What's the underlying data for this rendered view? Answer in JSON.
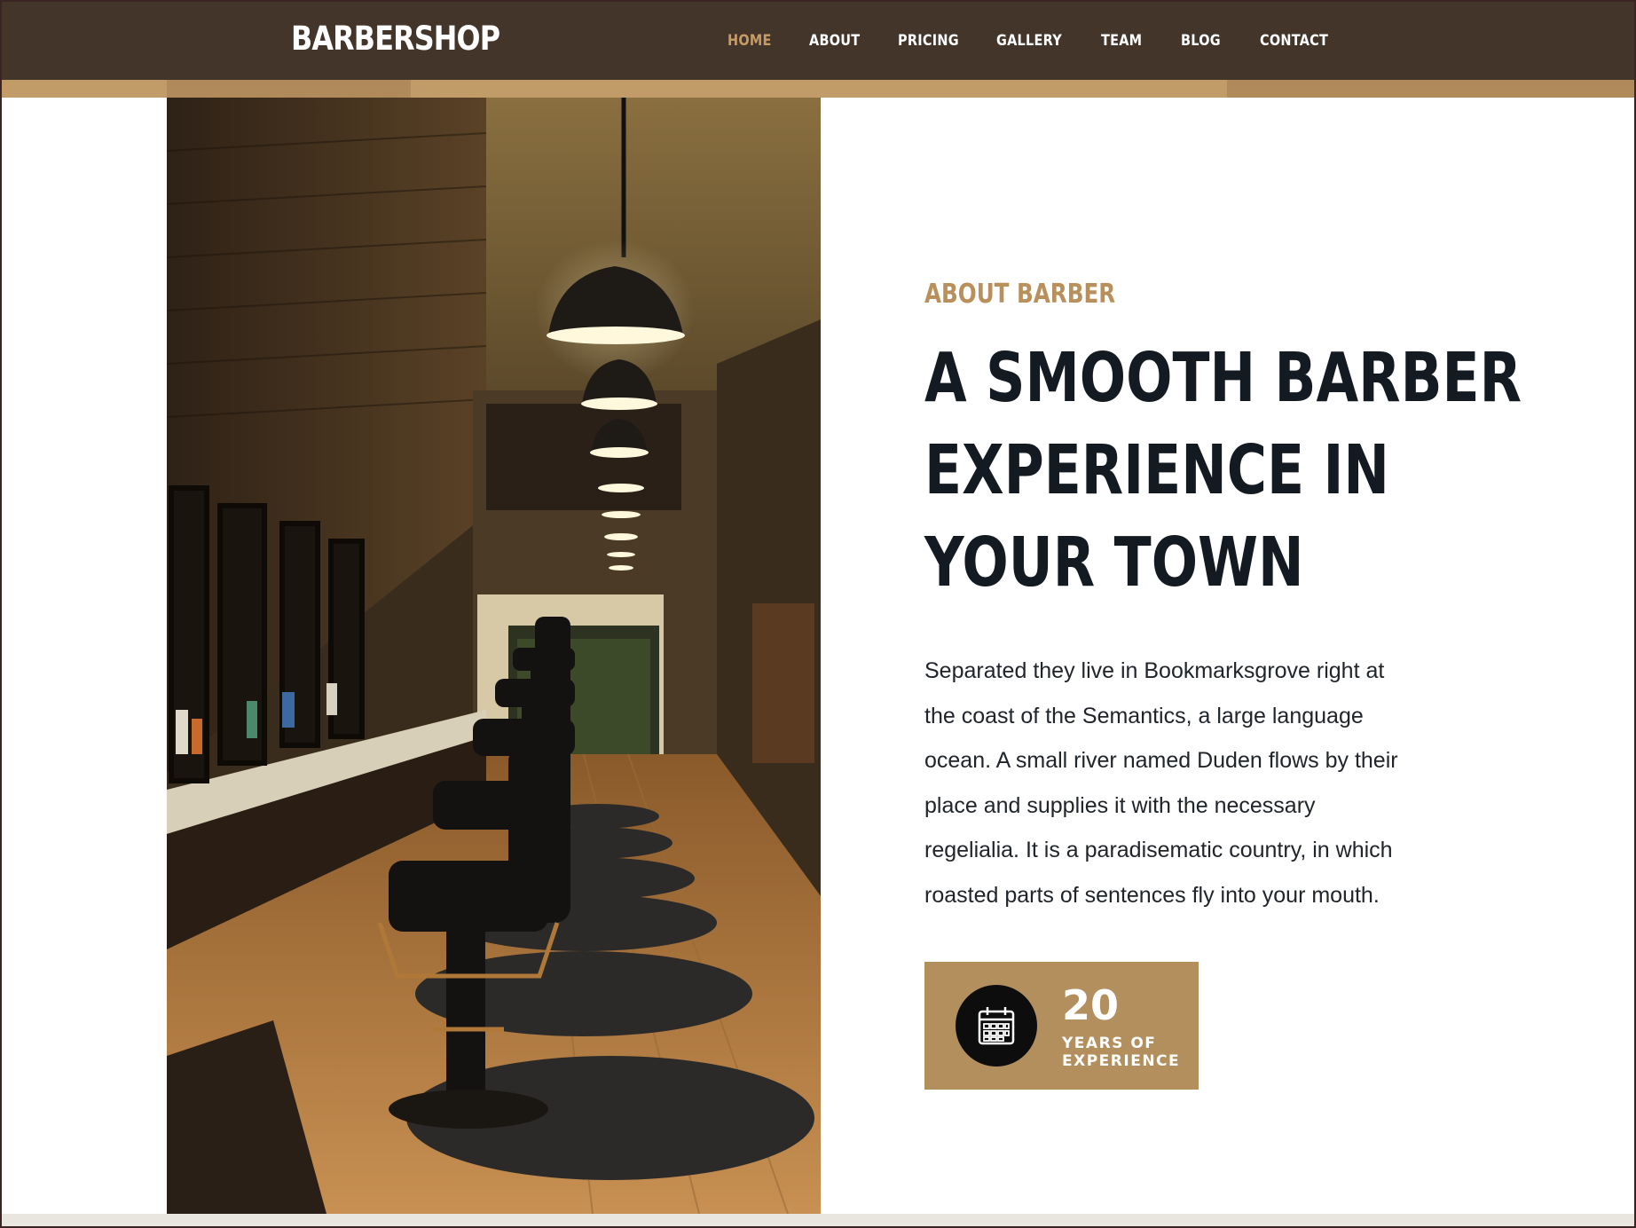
{
  "header": {
    "brand": "BARBERSHOP",
    "nav": [
      {
        "label": "HOME",
        "active": true
      },
      {
        "label": "ABOUT",
        "active": false
      },
      {
        "label": "PRICING",
        "active": false
      },
      {
        "label": "GALLERY",
        "active": false
      },
      {
        "label": "TEAM",
        "active": false
      },
      {
        "label": "BLOG",
        "active": false
      },
      {
        "label": "CONTACT",
        "active": false
      }
    ]
  },
  "hero": {
    "image_subject": "barbershop interior with row of barber chairs and pendant lamps"
  },
  "about": {
    "eyebrow": "ABOUT BARBER",
    "headline_lines": [
      "A SMOOTH BARBER",
      "EXPERIENCE IN",
      "YOUR TOWN"
    ],
    "body_lines": [
      "Separated they live in Bookmarksgrove right at",
      "the coast of the Semantics, a large language",
      "ocean. A small river named Duden flows by their",
      "place and supplies it with the necessary",
      "regelialia. It is a paradisematic country, in which",
      "roasted parts of sentences fly into your mouth."
    ],
    "badge": {
      "icon": "calendar-icon",
      "number": "20",
      "label_lines": [
        "YEARS OF",
        "EXPERIENCE"
      ]
    }
  },
  "colors": {
    "nav_bg": "#43352a",
    "accent": "#b38f5e",
    "active_link": "#c69c66",
    "headline": "#141a22"
  }
}
